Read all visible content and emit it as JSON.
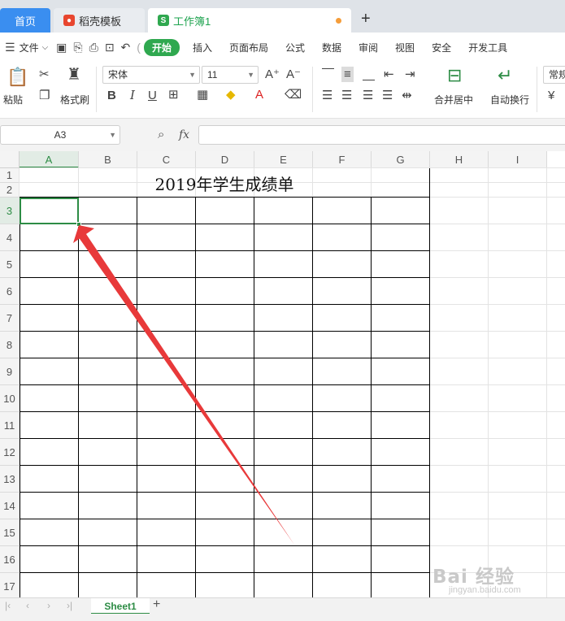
{
  "titlebar": {
    "tabs": [
      {
        "label": "首页"
      },
      {
        "label": "稻壳模板"
      },
      {
        "label": "工作簿1",
        "icon_letter": "S"
      }
    ],
    "new_tab": "+"
  },
  "menubar": {
    "file": "文件",
    "items": [
      "开始",
      "插入",
      "页面布局",
      "公式",
      "数据",
      "审阅",
      "视图",
      "安全",
      "开发工具"
    ]
  },
  "ribbon": {
    "paste": "粘贴",
    "format_painter": "格式刷",
    "font_name": "宋体",
    "font_size": "11",
    "merge_center": "合并居中",
    "auto_wrap": "自动换行",
    "number_format": "常规",
    "bold": "B",
    "italic": "I",
    "underline": "U"
  },
  "formula_bar": {
    "name_box": "A3",
    "fx": "fx",
    "content": ""
  },
  "grid": {
    "columns": [
      "A",
      "B",
      "C",
      "D",
      "E",
      "F",
      "G",
      "H",
      "I"
    ],
    "rows": [
      "1",
      "2",
      "3",
      "4",
      "5",
      "6",
      "7",
      "8",
      "9",
      "10",
      "11",
      "12",
      "13",
      "14",
      "15",
      "16",
      "17"
    ],
    "selected_cell": "A3",
    "title": "2019年学生成绩单"
  },
  "sheets": {
    "tabs": [
      "Sheet1"
    ],
    "active": "Sheet1"
  },
  "watermark": {
    "logo": "Bai 经验",
    "url": "jingyan.baidu.com"
  },
  "colors": {
    "accent_green": "#2d8c45",
    "home_tab_blue": "#3a8ef0",
    "annotation_arrow": "#e8393a"
  }
}
